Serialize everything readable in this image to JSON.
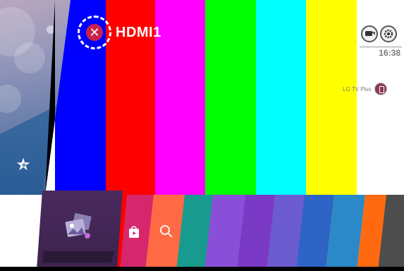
{
  "input_source": {
    "label": "HDMI1",
    "icon": "input-disconnected-icon"
  },
  "top_right": {
    "input_button_icon": "input-switch-icon",
    "settings_button_icon": "gear-icon",
    "clock": "16:38"
  },
  "channel_app": {
    "label": "LG TV Plus",
    "icon": "phone-icon"
  },
  "home": {
    "favorite_icon": "star-plus-icon"
  },
  "launcher": {
    "tiles": [
      {
        "name": "input-tile",
        "icon": "media-gallery-icon"
      },
      {
        "name": "lg-store-tile",
        "icon": "store-bag-icon"
      },
      {
        "name": "search-tile",
        "icon": "search-icon"
      },
      {
        "name": "app-tile-3"
      },
      {
        "name": "app-tile-4"
      },
      {
        "name": "app-tile-5"
      },
      {
        "name": "app-tile-6"
      },
      {
        "name": "app-tile-7"
      },
      {
        "name": "app-tile-8"
      },
      {
        "name": "app-tile-9"
      },
      {
        "name": "app-tile-10"
      }
    ]
  },
  "colors": {
    "bars": [
      "#ffffff",
      "#0000ff",
      "#ff0000",
      "#ff00ff",
      "#00ff00",
      "#00ffff",
      "#ffff00",
      "#ffffff"
    ],
    "selected_tile": "#4a2a5e",
    "store_tile": "#d6276c",
    "search_tile": "#ff6a45"
  }
}
